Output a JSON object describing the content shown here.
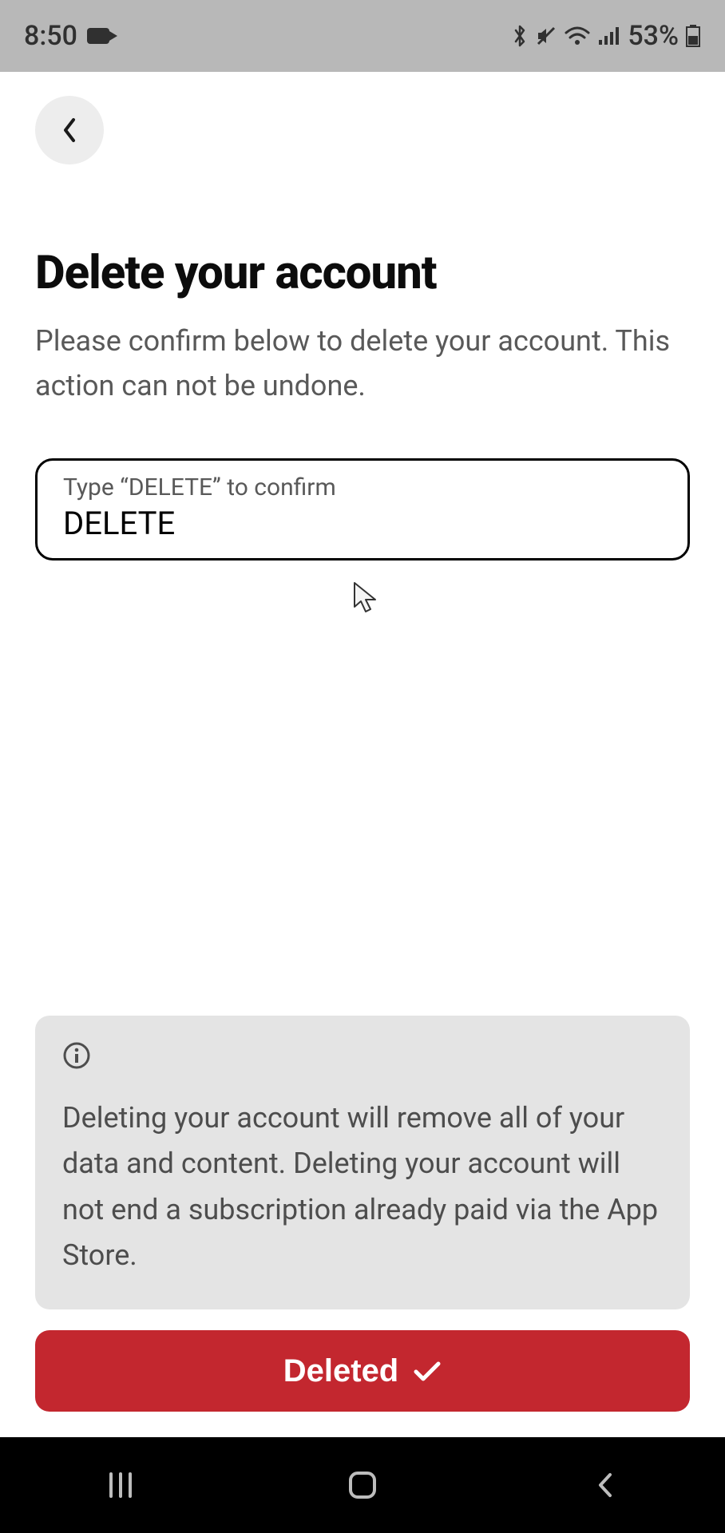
{
  "status_bar": {
    "time": "8:50",
    "battery": "53%"
  },
  "page": {
    "title": "Delete your account",
    "description": "Please confirm below to delete your account. This action can not be undone."
  },
  "confirm_field": {
    "label": "Type “DELETE” to confirm",
    "value": "DELETE"
  },
  "info_box": {
    "message": "Deleting your account will remove all of your data and content. Deleting your account will not end a subscription already paid via the App Store."
  },
  "action_button": {
    "label": "Deleted"
  }
}
